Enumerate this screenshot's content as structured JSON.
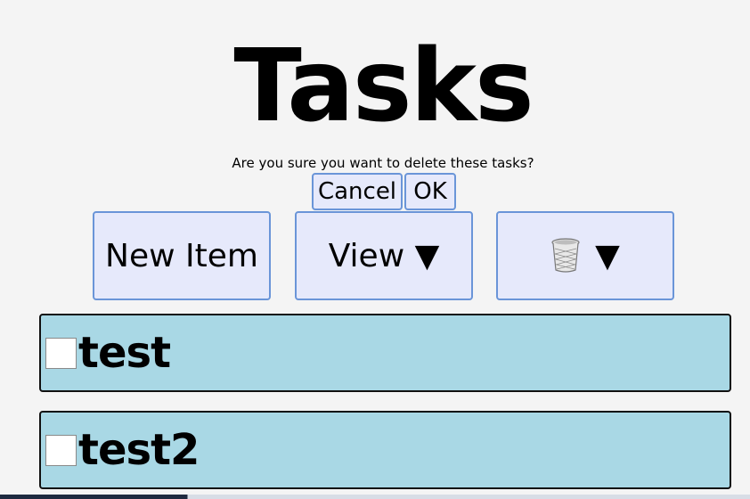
{
  "header": {
    "title": "Tasks"
  },
  "confirm_dialog": {
    "message": "Are you sure you want to delete these tasks?",
    "cancel_label": "Cancel",
    "ok_label": "OK"
  },
  "toolbar": {
    "new_item_label": "New Item",
    "view_label": "View ▼",
    "trash_menu_label": "▼",
    "trash_icon": "wastebasket-icon"
  },
  "tasks": [
    {
      "label": "test",
      "checked": false
    },
    {
      "label": "test2",
      "checked": false
    }
  ],
  "colors": {
    "background": "#f4f4f4",
    "button_bg": "#e6e9fb",
    "button_border": "#6a95d8",
    "task_bg": "#a9d8e5",
    "task_border": "#111111"
  }
}
